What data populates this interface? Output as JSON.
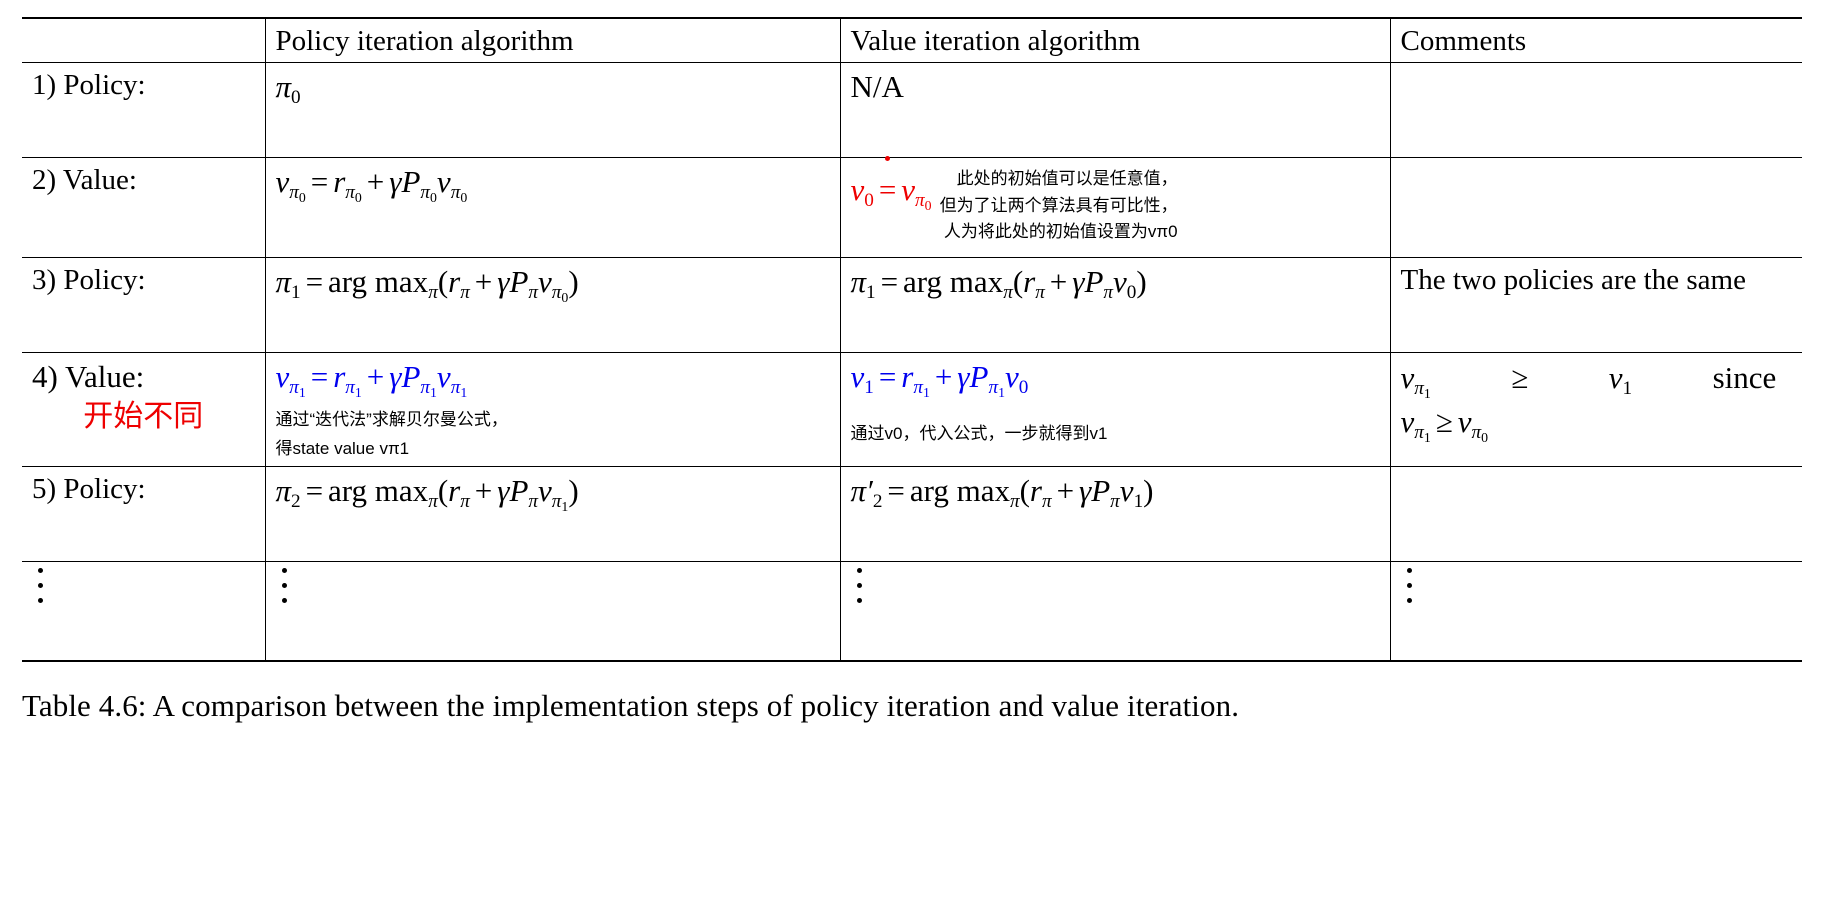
{
  "table": {
    "columns": [
      {
        "key": "step",
        "label": ""
      },
      {
        "key": "policy",
        "label": "Policy iteration algorithm"
      },
      {
        "key": "value",
        "label": "Value iteration algorithm"
      },
      {
        "key": "comments",
        "label": "Comments"
      }
    ],
    "rows": [
      {
        "step": "1) Policy:",
        "policy_formula": "π0",
        "value_formula": "N/A",
        "comments": ""
      },
      {
        "step": "2) Value:",
        "policy_formula": "vπ0 = rπ0 + γPπ0vπ0",
        "value_formula": "v0 ≐ vπ0",
        "value_formula_color": "#ee0000",
        "value_note_lines": [
          "此处的初始值可以是任意值，",
          "但为了让两个算法具有可比性，",
          "人为将此处的初始值设置为vπ0"
        ],
        "comments": ""
      },
      {
        "step": "3) Policy:",
        "policy_formula": "π1 = arg maxπ(rπ + γPπvπ0)",
        "value_formula": "π1 = arg maxπ(rπ + γPπv0)",
        "comments": "The two policies are the same"
      },
      {
        "step": "4) Value:",
        "step_annotation": "开始不同",
        "step_annotation_color": "#ee0000",
        "policy_formula": "vπ1 = rπ1 + γPπ1vπ1",
        "policy_formula_color": "#0000ee",
        "policy_note_lines": [
          "通过“迭代法”求解贝尔曼公式，",
          "得state value vπ1"
        ],
        "value_formula": "v1 = rπ1 + γPπ1v0",
        "value_formula_color": "#0000ee",
        "value_note_lines": [
          "通过v0，代入公式，一步就得到v1"
        ],
        "comments_line1": "vπ1  ≥  v1  since",
        "comments_line2": "vπ1 ≥ vπ0"
      },
      {
        "step": "5) Policy:",
        "policy_formula": "π2 = arg maxπ(rπ + γPπvπ1)",
        "value_formula": "π′2 = arg maxπ(rπ + γPπv1)",
        "comments": ""
      },
      {
        "step": "⋮",
        "policy_formula": "⋮",
        "value_formula": "⋮",
        "comments": "⋮"
      }
    ]
  },
  "caption": {
    "text": "Table 4.6: A comparison between the implementation steps of policy iteration and value iteration."
  },
  "colors": {
    "red": "#ee0000",
    "blue": "#0000ee",
    "rule": "#000000"
  }
}
